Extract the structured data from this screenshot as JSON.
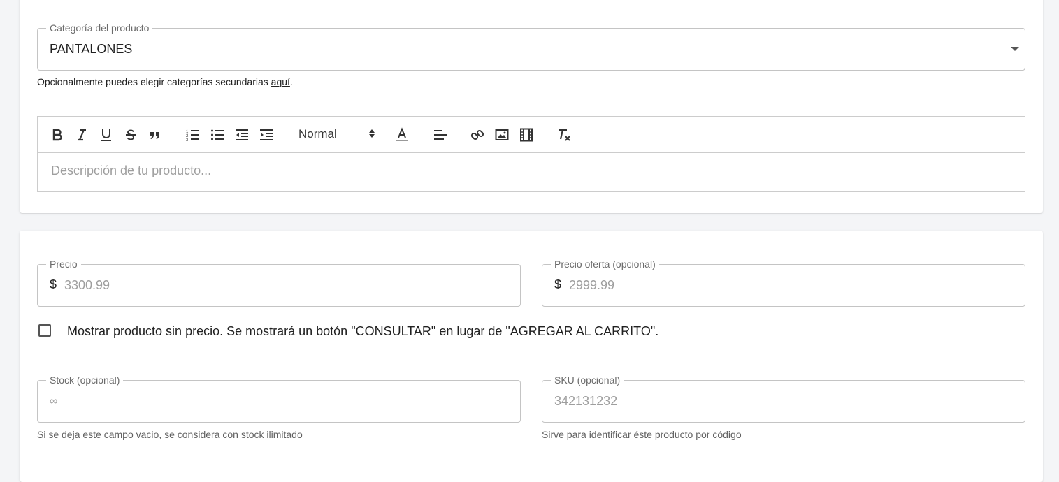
{
  "category": {
    "label": "Categoría del producto",
    "value": "PANTALONES",
    "helper_prefix": "Opcionalmente puedes elegir categorías secundarias",
    "helper_link": "aquí",
    "helper_suffix": "."
  },
  "editor": {
    "header_select": "Normal",
    "placeholder": "Descripción de tu producto...",
    "tools": [
      "bold-icon",
      "italic-icon",
      "underline-icon",
      "strikethrough-icon",
      "blockquote-icon",
      "ordered-list-icon",
      "bullet-list-icon",
      "outdent-icon",
      "indent-icon",
      "text-color-icon",
      "align-icon",
      "link-icon",
      "image-icon",
      "video-icon",
      "clear-format-icon"
    ]
  },
  "price": {
    "label": "Precio",
    "prefix": "$",
    "placeholder": "3300.99"
  },
  "sale_price": {
    "label": "Precio oferta (opcional)",
    "prefix": "$",
    "placeholder": "2999.99"
  },
  "no_price": {
    "label": "Mostrar producto sin precio. Se mostrará un botón \"CONSULTAR\" en lugar de \"AGREGAR AL CARRITO\".",
    "checked": false
  },
  "stock": {
    "label": "Stock (opcional)",
    "placeholder": "∞",
    "helper": "Si se deja este campo vacio, se considera con stock ilimitado"
  },
  "sku": {
    "label": "SKU (opcional)",
    "placeholder": "342131232",
    "helper": "Sirve para identificar éste producto por código"
  }
}
